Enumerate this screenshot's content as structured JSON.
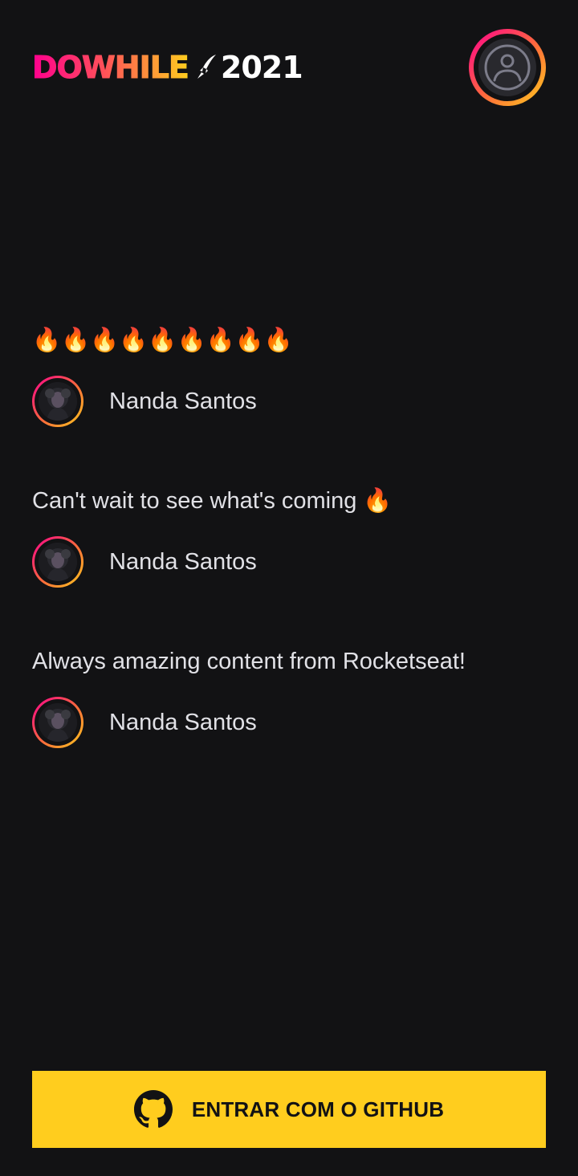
{
  "header": {
    "logo": {
      "brand": "DOWHILE",
      "year": "2021"
    },
    "user_avatar_icon": "user-icon"
  },
  "messages": [
    {
      "text": "🔥🔥🔥🔥🔥🔥🔥🔥🔥",
      "author": "Nanda Santos"
    },
    {
      "text": "Can't wait to see what's coming 🔥",
      "author": "Nanda Santos"
    },
    {
      "text": "Always amazing content from Rocketseat!",
      "author": "Nanda Santos"
    }
  ],
  "login_button": {
    "label": "ENTRAR COM O GITHUB",
    "icon": "github-icon"
  },
  "colors": {
    "background": "#121214",
    "text": "#e1e1e6",
    "button": "#ffcd1e",
    "gradient_start": "#ff008e",
    "gradient_end": "#ffcd1e"
  }
}
